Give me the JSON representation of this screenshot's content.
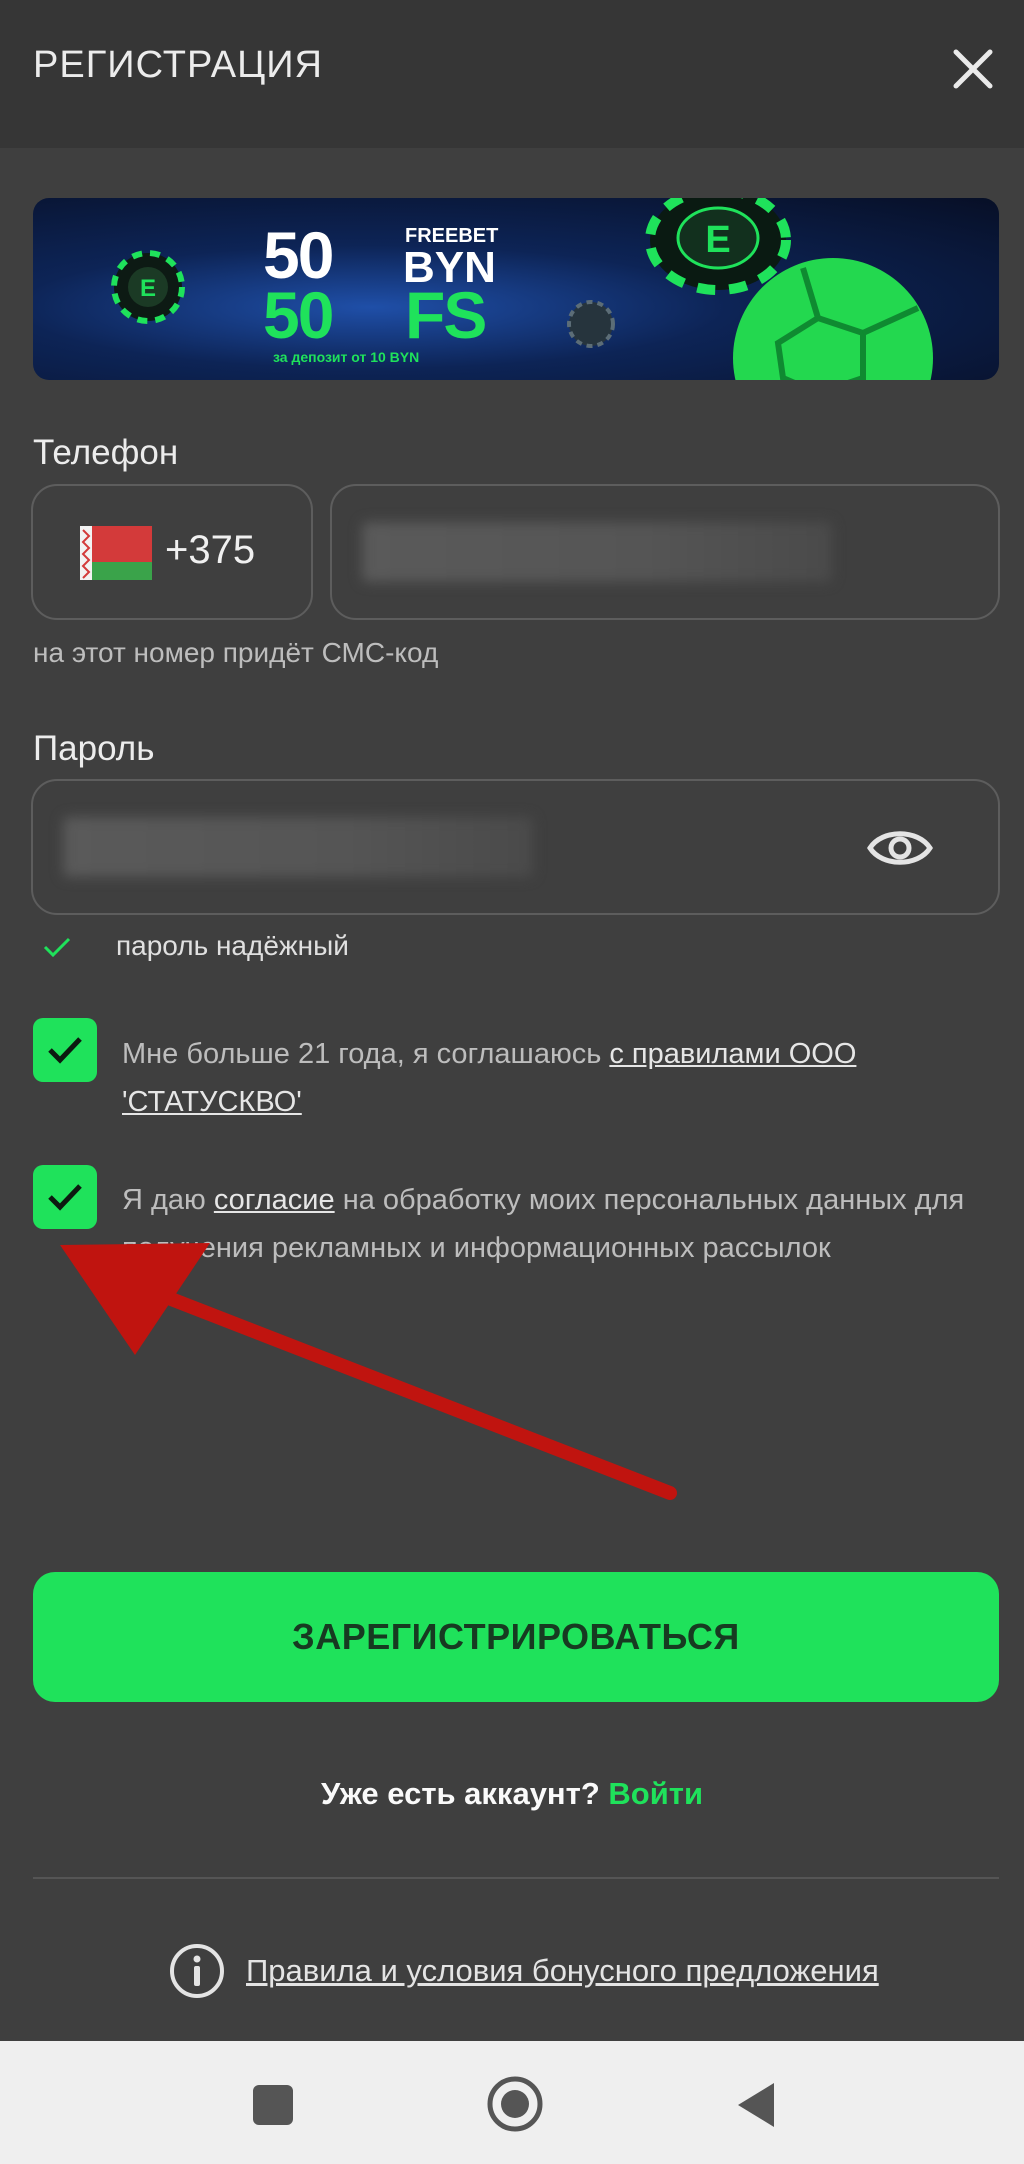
{
  "header": {
    "title": "РЕГИСТРАЦИЯ"
  },
  "banner": {
    "amount": "50",
    "freebet": "FREEBET",
    "currency": "BYN",
    "fs_amount": "50",
    "fs": "FS",
    "deposit_note": "за депозит от 10 BYN",
    "logo_letter": "E"
  },
  "phone": {
    "label": "Телефон",
    "country_code": "+375",
    "hint": "на этот номер придёт СМС-код"
  },
  "password": {
    "label": "Пароль",
    "strength": "пароль надёжный"
  },
  "checkbox_age": {
    "text": "Мне больше 21 года, я соглашаюсь ",
    "link": "с правилами ООО 'СТАТУСКВО'"
  },
  "checkbox_consent": {
    "text_before": "Я даю ",
    "link": "согласие",
    "text_after": " на обработку моих персональных данных для получения рекламных и информационных рассылок"
  },
  "register_button": "ЗАРЕГИСТРИРОВАТЬСЯ",
  "account": {
    "question": "Уже есть аккаунт?",
    "login": "Войти"
  },
  "rules_link": "Правила и условия бонусного предложения",
  "colors": {
    "accent": "#1fe25b",
    "background": "#3f3f3f",
    "header": "#363636",
    "arrow": "#c0140f"
  }
}
